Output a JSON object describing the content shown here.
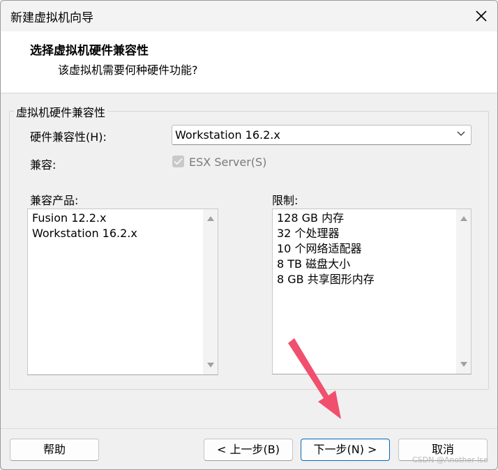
{
  "window": {
    "title": "新建虚拟机向导",
    "close_icon": "close-icon"
  },
  "header": {
    "title": "选择虚拟机硬件兼容性",
    "subtitle": "该虚拟机需要何种硬件功能?"
  },
  "group": {
    "legend": "虚拟机硬件兼容性",
    "hw_compat_label": "硬件兼容性(H):",
    "hw_compat_value": "Workstation 16.2.x",
    "compat_label": "兼容:",
    "esx_label": "ESX Server(S)",
    "esx_checked": true,
    "esx_enabled": false
  },
  "products": {
    "label": "兼容产品:",
    "items": [
      "Fusion 12.2.x",
      "Workstation 16.2.x"
    ]
  },
  "limits": {
    "label": "限制:",
    "items": [
      "128 GB 内存",
      "32 个处理器",
      "10 个网络适配器",
      "8 TB 磁盘大小",
      "8 GB 共享图形内存"
    ]
  },
  "buttons": {
    "help": "帮助",
    "back": "< 上一步(B)",
    "next": "下一步(N) >",
    "cancel": "取消"
  },
  "colors": {
    "accent": "#0067c0",
    "annotation_arrow": "#f0506e"
  },
  "watermark": "CSDN @Another Iso"
}
